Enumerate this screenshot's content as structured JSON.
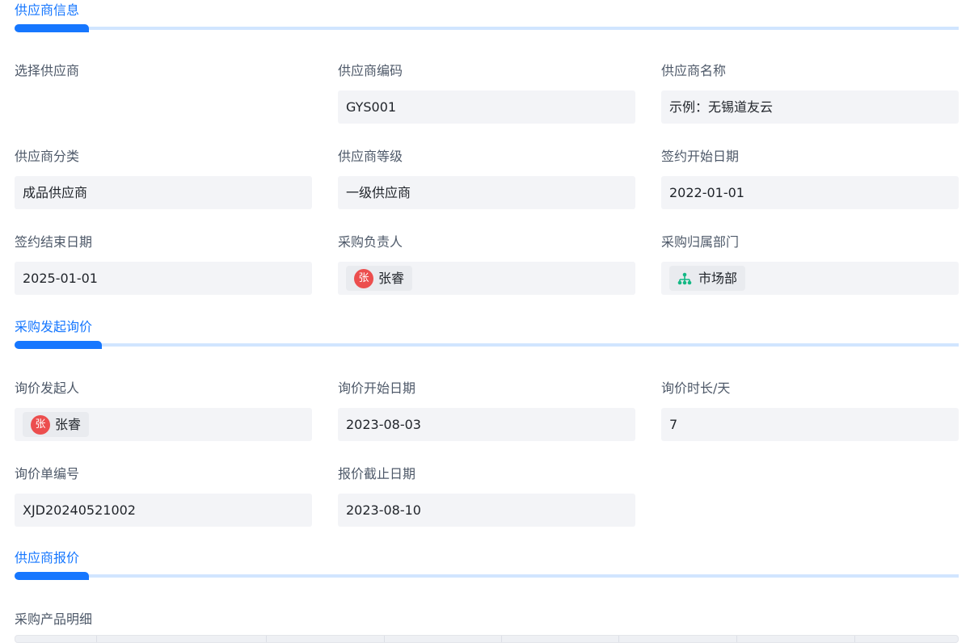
{
  "sections": [
    {
      "title": "供应商信息"
    },
    {
      "title": "采购发起询价"
    },
    {
      "title": "供应商报价"
    }
  ],
  "supplier": {
    "select_label": "选择供应商",
    "code_label": "供应商编码",
    "code": "GYS001",
    "name_label": "供应商名称",
    "name": "示例：无锡道友云",
    "category_label": "供应商分类",
    "category": "成品供应商",
    "level_label": "供应商等级",
    "level": "一级供应商",
    "start_label": "签约开始日期",
    "start": "2022-01-01",
    "end_label": "签约结束日期",
    "end": "2025-01-01",
    "owner_label": "采购负责人",
    "owner": "张睿",
    "owner_avatar": "张",
    "dept_label": "采购归属部门",
    "dept": "市场部"
  },
  "inquiry": {
    "initiator_label": "询价发起人",
    "initiator": "张睿",
    "initiator_avatar": "张",
    "start_label": "询价开始日期",
    "start": "2023-08-03",
    "duration_label": "询价时长/天",
    "duration": "7",
    "number_label": "询价单编号",
    "number": "XJD20240521002",
    "deadline_label": "报价截止日期",
    "deadline": "2023-08-10"
  },
  "quote": {
    "detail_label": "采购产品明细"
  },
  "colors": {
    "accent": "#1677ff",
    "avatar": "#ec4e4e",
    "org_icon": "#14b885"
  }
}
